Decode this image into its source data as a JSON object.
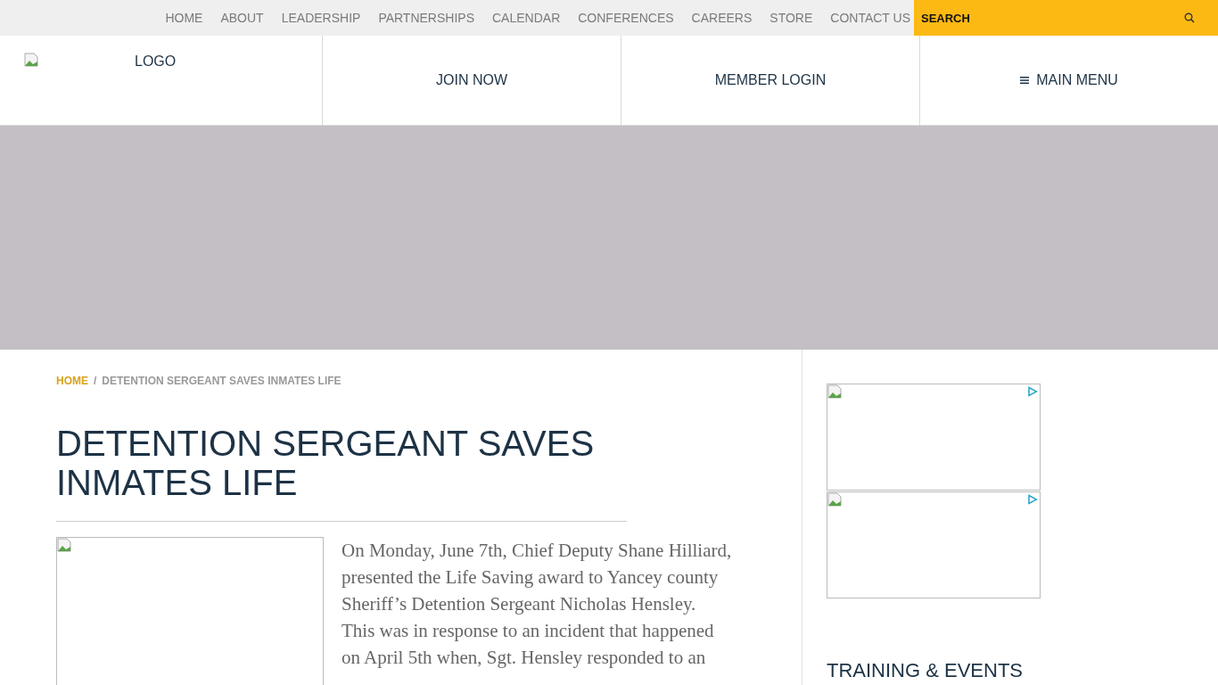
{
  "top_nav": [
    {
      "label": "HOME"
    },
    {
      "label": "ABOUT"
    },
    {
      "label": "LEADERSHIP"
    },
    {
      "label": "PARTNERSHIPS"
    },
    {
      "label": "CALENDAR"
    },
    {
      "label": "CONFERENCES"
    },
    {
      "label": "CAREERS"
    },
    {
      "label": "STORE"
    },
    {
      "label": "CONTACT US"
    }
  ],
  "search": {
    "placeholder": "SEARCH"
  },
  "header": {
    "logo_alt": "LOGO",
    "join": "JOIN NOW",
    "login": "MEMBER LOGIN",
    "menu": "MAIN MENU"
  },
  "breadcrumb": [
    {
      "label": "HOME",
      "kind": "link"
    },
    {
      "label": "/",
      "kind": "separator"
    },
    {
      "label": "DETENTION SERGEANT SAVES INMATES LIFE",
      "kind": "current"
    }
  ],
  "article": {
    "title": "DETENTION SERGEANT SAVES INMATES LIFE",
    "lines": [
      "On Monday, June 7th, Chief Deputy Shane Hilliard,",
      "presented the Life Saving award to Yancey county",
      "Sheriff’s Detention Sergeant Nicholas Hensley.",
      "This was in response to an incident that happened",
      "on April 5th when, Sgt. Hensley responded to an"
    ]
  },
  "sidebar": {
    "ads": [
      {
        "kind": "ad"
      },
      {
        "kind": "ad"
      }
    ],
    "heading": "TRAINING & EVENTS"
  }
}
